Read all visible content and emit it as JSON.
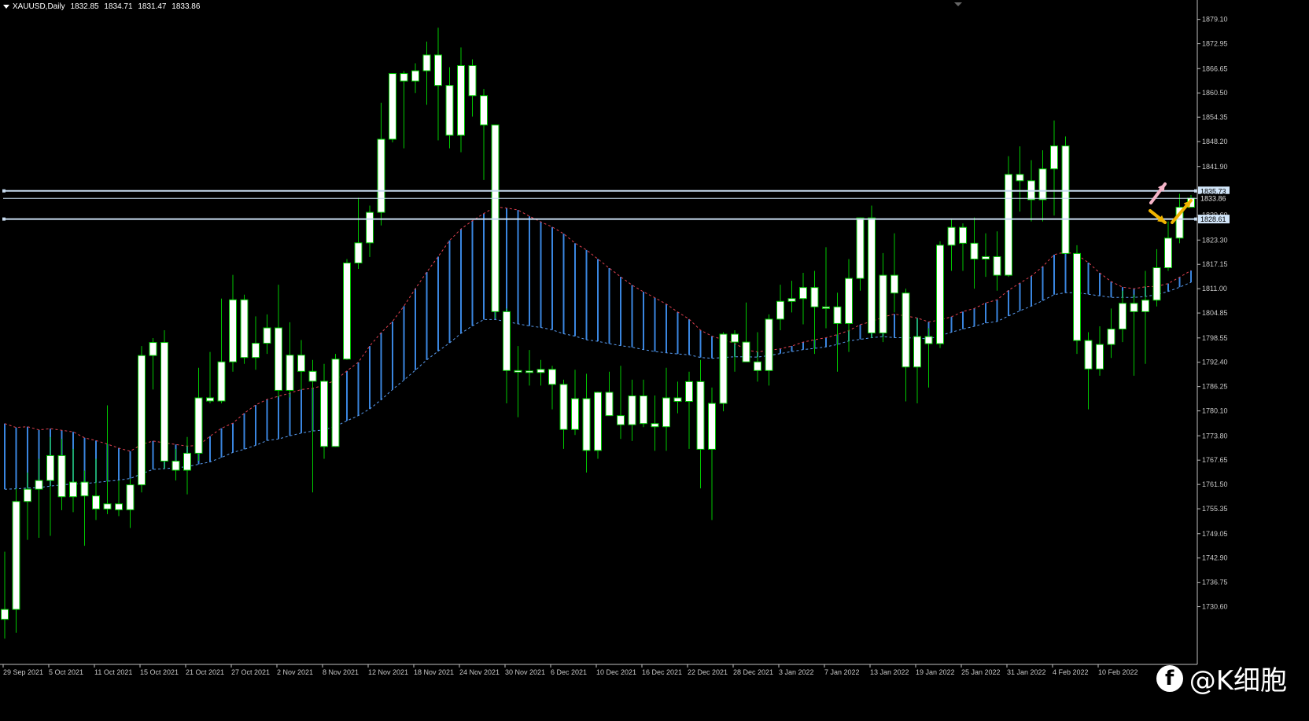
{
  "header": {
    "symbol": "XAUUSD,Daily",
    "open": "1832.85",
    "high": "1834.71",
    "low": "1831.47",
    "close": "1833.86"
  },
  "watermark": {
    "text": "@K细胞",
    "icon": "facebook-icon"
  },
  "colors": {
    "background": "#000000",
    "bull_wick": "#00c800",
    "candle_body": "#ffffff",
    "axis": "#c0c0c0",
    "blue_band": "#3a86e0",
    "red_band": "#d2283c",
    "hline": "#c8dcf0",
    "arrow_pink": "#f5b4c8",
    "arrow_yellow": "#f0b400"
  },
  "hlines": [
    {
      "price": 1835.73,
      "label": "1835.73"
    },
    {
      "price": 1833.86,
      "label": "1833.86"
    },
    {
      "price": 1828.61,
      "label": "1828.61"
    }
  ],
  "chart_data": {
    "type": "candlestick",
    "y_ticks": [
      "1879.10",
      "1872.95",
      "1866.65",
      "1860.50",
      "1854.35",
      "1848.20",
      "1841.90",
      "1829.60",
      "1823.30",
      "1817.15",
      "1811.00",
      "1804.85",
      "1798.55",
      "1792.40",
      "1786.25",
      "1780.10",
      "1773.80",
      "1767.65",
      "1761.50",
      "1755.35",
      "1749.05",
      "1742.90",
      "1736.75",
      "1730.60"
    ],
    "x_labels": [
      "29 Sep 2021",
      "5 Oct 2021",
      "11 Oct 2021",
      "15 Oct 2021",
      "21 Oct 2021",
      "27 Oct 2021",
      "2 Nov 2021",
      "8 Nov 2021",
      "12 Nov 2021",
      "18 Nov 2021",
      "24 Nov 2021",
      "30 Nov 2021",
      "6 Dec 2021",
      "10 Dec 2021",
      "16 Dec 2021",
      "22 Dec 2021",
      "28 Dec 2021",
      "3 Jan 2022",
      "7 Jan 2022",
      "13 Jan 2022",
      "19 Jan 2022",
      "25 Jan 2022",
      "31 Jan 2022",
      "4 Feb 2022",
      "10 Feb 2022"
    ],
    "ylim": [
      1716.0,
      1884.0
    ],
    "candles": [
      [
        1727.4,
        1744.5,
        1722.5,
        1729.9
      ],
      [
        1729.9,
        1760.5,
        1724.0,
        1757.2
      ],
      [
        1757.2,
        1764.5,
        1747.5,
        1760.3
      ],
      [
        1760.3,
        1768.0,
        1748.0,
        1762.5
      ],
      [
        1762.5,
        1773.5,
        1748.5,
        1768.8
      ],
      [
        1768.8,
        1773.0,
        1755.0,
        1758.4
      ],
      [
        1758.4,
        1770.5,
        1754.5,
        1762.1
      ],
      [
        1762.1,
        1765.0,
        1746.0,
        1758.6
      ],
      [
        1758.6,
        1768.0,
        1752.5,
        1755.3
      ],
      [
        1755.3,
        1781.5,
        1754.0,
        1756.6
      ],
      [
        1756.6,
        1762.5,
        1753.5,
        1755.1
      ],
      [
        1755.1,
        1763.0,
        1750.5,
        1761.4
      ],
      [
        1761.4,
        1796.5,
        1759.5,
        1794.1
      ],
      [
        1794.1,
        1798.5,
        1785.5,
        1797.4
      ],
      [
        1797.4,
        1800.5,
        1765.5,
        1767.4
      ],
      [
        1767.4,
        1770.5,
        1762.5,
        1765.1
      ],
      [
        1765.1,
        1773.5,
        1759.0,
        1769.4
      ],
      [
        1769.4,
        1791.0,
        1767.5,
        1783.4
      ],
      [
        1783.4,
        1795.0,
        1782.0,
        1782.6
      ],
      [
        1782.6,
        1808.5,
        1782.0,
        1792.5
      ],
      [
        1792.5,
        1814.5,
        1790.0,
        1808.2
      ],
      [
        1808.2,
        1809.5,
        1792.0,
        1793.6
      ],
      [
        1793.6,
        1804.0,
        1790.5,
        1797.2
      ],
      [
        1797.2,
        1804.5,
        1794.5,
        1801.1
      ],
      [
        1801.1,
        1812.0,
        1783.5,
        1785.3
      ],
      [
        1785.3,
        1802.5,
        1783.5,
        1794.2
      ],
      [
        1794.2,
        1798.0,
        1785.5,
        1790.1
      ],
      [
        1790.1,
        1793.0,
        1759.5,
        1787.6
      ],
      [
        1787.6,
        1792.0,
        1768.0,
        1771.1
      ],
      [
        1771.1,
        1794.5,
        1771.0,
        1793.2
      ],
      [
        1793.2,
        1818.5,
        1793.0,
        1817.5
      ],
      [
        1817.5,
        1834.0,
        1816.0,
        1822.6
      ],
      [
        1822.6,
        1832.0,
        1819.0,
        1830.3
      ],
      [
        1830.3,
        1858.0,
        1827.0,
        1848.8
      ],
      [
        1848.8,
        1864.0,
        1848.0,
        1865.4
      ],
      [
        1865.4,
        1866.0,
        1846.5,
        1863.5
      ],
      [
        1863.5,
        1868.0,
        1860.5,
        1866.1
      ],
      [
        1866.1,
        1873.5,
        1857.5,
        1870.1
      ],
      [
        1870.1,
        1877.0,
        1848.5,
        1862.4
      ],
      [
        1862.4,
        1867.0,
        1846.5,
        1849.8
      ],
      [
        1849.8,
        1872.0,
        1845.5,
        1867.4
      ],
      [
        1867.4,
        1869.0,
        1854.5,
        1859.8
      ],
      [
        1859.8,
        1861.5,
        1838.5,
        1852.4
      ],
      [
        1852.4,
        1845.5,
        1803.5,
        1805.2
      ],
      [
        1805.2,
        1806.0,
        1782.0,
        1790.3
      ],
      [
        1790.3,
        1796.5,
        1778.5,
        1790.2
      ],
      [
        1790.2,
        1795.5,
        1786.5,
        1789.8
      ],
      [
        1789.8,
        1793.0,
        1786.5,
        1790.6
      ],
      [
        1790.6,
        1791.5,
        1780.5,
        1786.8
      ],
      [
        1786.8,
        1788.0,
        1770.5,
        1775.4
      ],
      [
        1775.4,
        1790.5,
        1774.0,
        1783.2
      ],
      [
        1783.2,
        1789.5,
        1764.5,
        1770.1
      ],
      [
        1770.1,
        1785.0,
        1768.0,
        1784.8
      ],
      [
        1784.8,
        1790.0,
        1782.5,
        1778.9
      ],
      [
        1778.9,
        1791.5,
        1773.0,
        1776.6
      ],
      [
        1776.6,
        1788.0,
        1772.5,
        1783.9
      ],
      [
        1783.9,
        1788.0,
        1776.0,
        1776.9
      ],
      [
        1776.9,
        1784.0,
        1770.0,
        1776.1
      ],
      [
        1776.1,
        1791.0,
        1770.0,
        1783.4
      ],
      [
        1783.4,
        1787.5,
        1779.5,
        1782.5
      ],
      [
        1782.5,
        1790.0,
        1770.5,
        1787.5
      ],
      [
        1787.5,
        1793.0,
        1760.5,
        1770.4
      ],
      [
        1770.4,
        1786.0,
        1752.5,
        1782.0
      ],
      [
        1782.0,
        1800.0,
        1780.0,
        1799.5
      ],
      [
        1799.5,
        1800.5,
        1790.0,
        1797.5
      ],
      [
        1797.5,
        1807.5,
        1795.5,
        1792.5
      ],
      [
        1792.5,
        1800.0,
        1787.5,
        1790.3
      ],
      [
        1790.3,
        1804.5,
        1786.5,
        1803.3
      ],
      [
        1803.3,
        1812.0,
        1800.5,
        1807.8
      ],
      [
        1807.8,
        1813.0,
        1805.0,
        1808.5
      ],
      [
        1808.5,
        1815.0,
        1802.0,
        1811.3
      ],
      [
        1811.3,
        1815.5,
        1794.5,
        1806.4
      ],
      [
        1806.4,
        1821.5,
        1801.0,
        1806.4
      ],
      [
        1806.4,
        1810.0,
        1790.0,
        1802.2
      ],
      [
        1802.2,
        1818.5,
        1795.0,
        1813.6
      ],
      [
        1813.6,
        1829.0,
        1810.5,
        1828.9
      ],
      [
        1828.9,
        1832.0,
        1798.5,
        1799.8
      ],
      [
        1799.8,
        1820.0,
        1797.5,
        1814.4
      ],
      [
        1814.4,
        1825.0,
        1805.0,
        1809.9
      ],
      [
        1809.9,
        1811.0,
        1782.5,
        1791.2
      ],
      [
        1791.2,
        1803.5,
        1782.0,
        1798.9
      ],
      [
        1798.9,
        1801.0,
        1786.0,
        1797.1
      ],
      [
        1797.1,
        1823.0,
        1796.0,
        1822.0
      ],
      [
        1822.0,
        1828.5,
        1815.5,
        1826.5
      ],
      [
        1826.5,
        1827.5,
        1815.5,
        1822.5
      ],
      [
        1822.5,
        1829.0,
        1811.0,
        1818.5
      ],
      [
        1818.5,
        1825.0,
        1814.0,
        1819.1
      ],
      [
        1819.1,
        1825.5,
        1810.5,
        1814.4
      ],
      [
        1814.4,
        1844.5,
        1814.0,
        1839.9
      ],
      [
        1839.9,
        1847.0,
        1830.5,
        1838.3
      ],
      [
        1838.3,
        1843.5,
        1828.0,
        1833.5
      ],
      [
        1833.5,
        1846.0,
        1828.0,
        1841.3
      ],
      [
        1841.3,
        1853.5,
        1829.5,
        1847.1
      ],
      [
        1847.1,
        1849.5,
        1821.0,
        1819.9
      ],
      [
        1819.9,
        1822.0,
        1794.5,
        1797.9
      ],
      [
        1797.9,
        1800.0,
        1780.5,
        1790.7
      ],
      [
        1790.7,
        1801.5,
        1789.0,
        1796.9
      ],
      [
        1796.9,
        1806.0,
        1793.5,
        1800.8
      ],
      [
        1800.8,
        1810.5,
        1797.5,
        1807.3
      ],
      [
        1807.3,
        1809.5,
        1789.0,
        1805.2
      ],
      [
        1805.2,
        1815.5,
        1792.0,
        1808.1
      ],
      [
        1808.1,
        1821.0,
        1806.5,
        1816.3
      ],
      [
        1816.3,
        1828.0,
        1815.5,
        1823.8
      ],
      [
        1823.8,
        1835.0,
        1822.5,
        1831.6
      ],
      [
        1831.6,
        1834.7,
        1831.5,
        1833.9
      ]
    ],
    "fast_ma": [
      1776.9,
      1775.9,
      1776.1,
      1775.3,
      1775.6,
      1775.2,
      1774.8,
      1773.3,
      1772.6,
      1771.7,
      1770.7,
      1769.9,
      1771.6,
      1772.5,
      1772.0,
      1771.6,
      1771.2,
      1771.4,
      1773.7,
      1775.7,
      1777.0,
      1779.5,
      1781.6,
      1783.0,
      1783.8,
      1784.6,
      1785.5,
      1785.8,
      1786.6,
      1787.9,
      1790.2,
      1792.4,
      1796.5,
      1799.9,
      1802.7,
      1806.6,
      1811.0,
      1815.2,
      1819.1,
      1823.2,
      1826.1,
      1828.2,
      1830.0,
      1831.7,
      1831.4,
      1830.9,
      1829.3,
      1827.9,
      1826.6,
      1824.9,
      1822.5,
      1820.8,
      1818.5,
      1816.2,
      1814.0,
      1811.9,
      1810.2,
      1808.7,
      1807.1,
      1805.1,
      1803.3,
      1800.5,
      1799.0,
      1798.1,
      1797.2,
      1795.5,
      1795.0,
      1795.4,
      1795.8,
      1796.5,
      1797.5,
      1798.1,
      1798.6,
      1799.4,
      1800.4,
      1801.9,
      1802.7,
      1803.8,
      1804.6,
      1804.1,
      1803.6,
      1802.6,
      1803.1,
      1803.9,
      1805.2,
      1806.0,
      1807.4,
      1808.2,
      1810.6,
      1812.4,
      1814.2,
      1816.6,
      1819.6,
      1820.3,
      1819.6,
      1817.6,
      1815.0,
      1812.8,
      1811.4,
      1811.0,
      1811.5,
      1811.6,
      1812.3,
      1813.9,
      1815.6
    ],
    "slow_ma": [
      1760.3,
      1760.4,
      1760.6,
      1760.7,
      1761.1,
      1761.4,
      1761.6,
      1761.7,
      1762.0,
      1762.3,
      1762.6,
      1763.0,
      1764.2,
      1765.3,
      1765.5,
      1765.7,
      1766.0,
      1766.6,
      1767.2,
      1768.3,
      1769.6,
      1770.4,
      1771.4,
      1772.6,
      1773.0,
      1773.8,
      1774.5,
      1775.0,
      1775.3,
      1776.2,
      1777.6,
      1778.9,
      1780.6,
      1782.9,
      1785.5,
      1787.9,
      1790.4,
      1793.0,
      1795.2,
      1797.3,
      1799.7,
      1801.6,
      1803.2,
      1803.2,
      1802.7,
      1802.1,
      1801.6,
      1801.2,
      1800.6,
      1799.6,
      1799.0,
      1798.1,
      1797.7,
      1797.1,
      1796.6,
      1796.2,
      1795.6,
      1795.1,
      1794.8,
      1794.5,
      1794.3,
      1793.6,
      1793.4,
      1793.6,
      1793.8,
      1793.8,
      1793.7,
      1794.1,
      1794.6,
      1795.1,
      1795.6,
      1795.9,
      1796.3,
      1796.9,
      1797.8,
      1798.2,
      1798.6,
      1798.9,
      1798.6,
      1798.6,
      1798.5,
      1798.3,
      1799.1,
      1800.0,
      1800.8,
      1801.5,
      1802.3,
      1802.7,
      1804.1,
      1805.4,
      1806.6,
      1808.0,
      1809.5,
      1810.0,
      1810.0,
      1809.6,
      1809.2,
      1808.8,
      1808.8,
      1808.8,
      1809.0,
      1809.5,
      1810.3,
      1811.4,
      1812.6
    ]
  }
}
